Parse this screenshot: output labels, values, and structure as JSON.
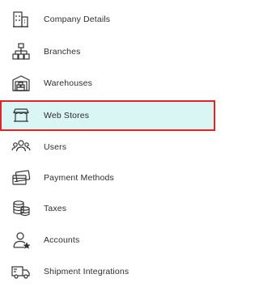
{
  "menu": {
    "items": [
      {
        "label": "Company Details",
        "icon": "building-icon"
      },
      {
        "label": "Branches",
        "icon": "branches-icon"
      },
      {
        "label": "Warehouses",
        "icon": "warehouse-icon"
      },
      {
        "label": "Web Stores",
        "icon": "storefront-icon",
        "selected": true
      },
      {
        "label": "Users",
        "icon": "users-icon"
      },
      {
        "label": "Payment Methods",
        "icon": "credit-card-icon"
      },
      {
        "label": "Taxes",
        "icon": "coins-stack-icon"
      },
      {
        "label": "Accounts",
        "icon": "account-user-icon"
      },
      {
        "label": "Shipment Integrations",
        "icon": "truck-icon"
      }
    ]
  },
  "colors": {
    "selected_background": "#d9f5f4",
    "selected_border": "#e8202a",
    "text": "#2d2d2d",
    "icon_stroke": "#333333"
  }
}
